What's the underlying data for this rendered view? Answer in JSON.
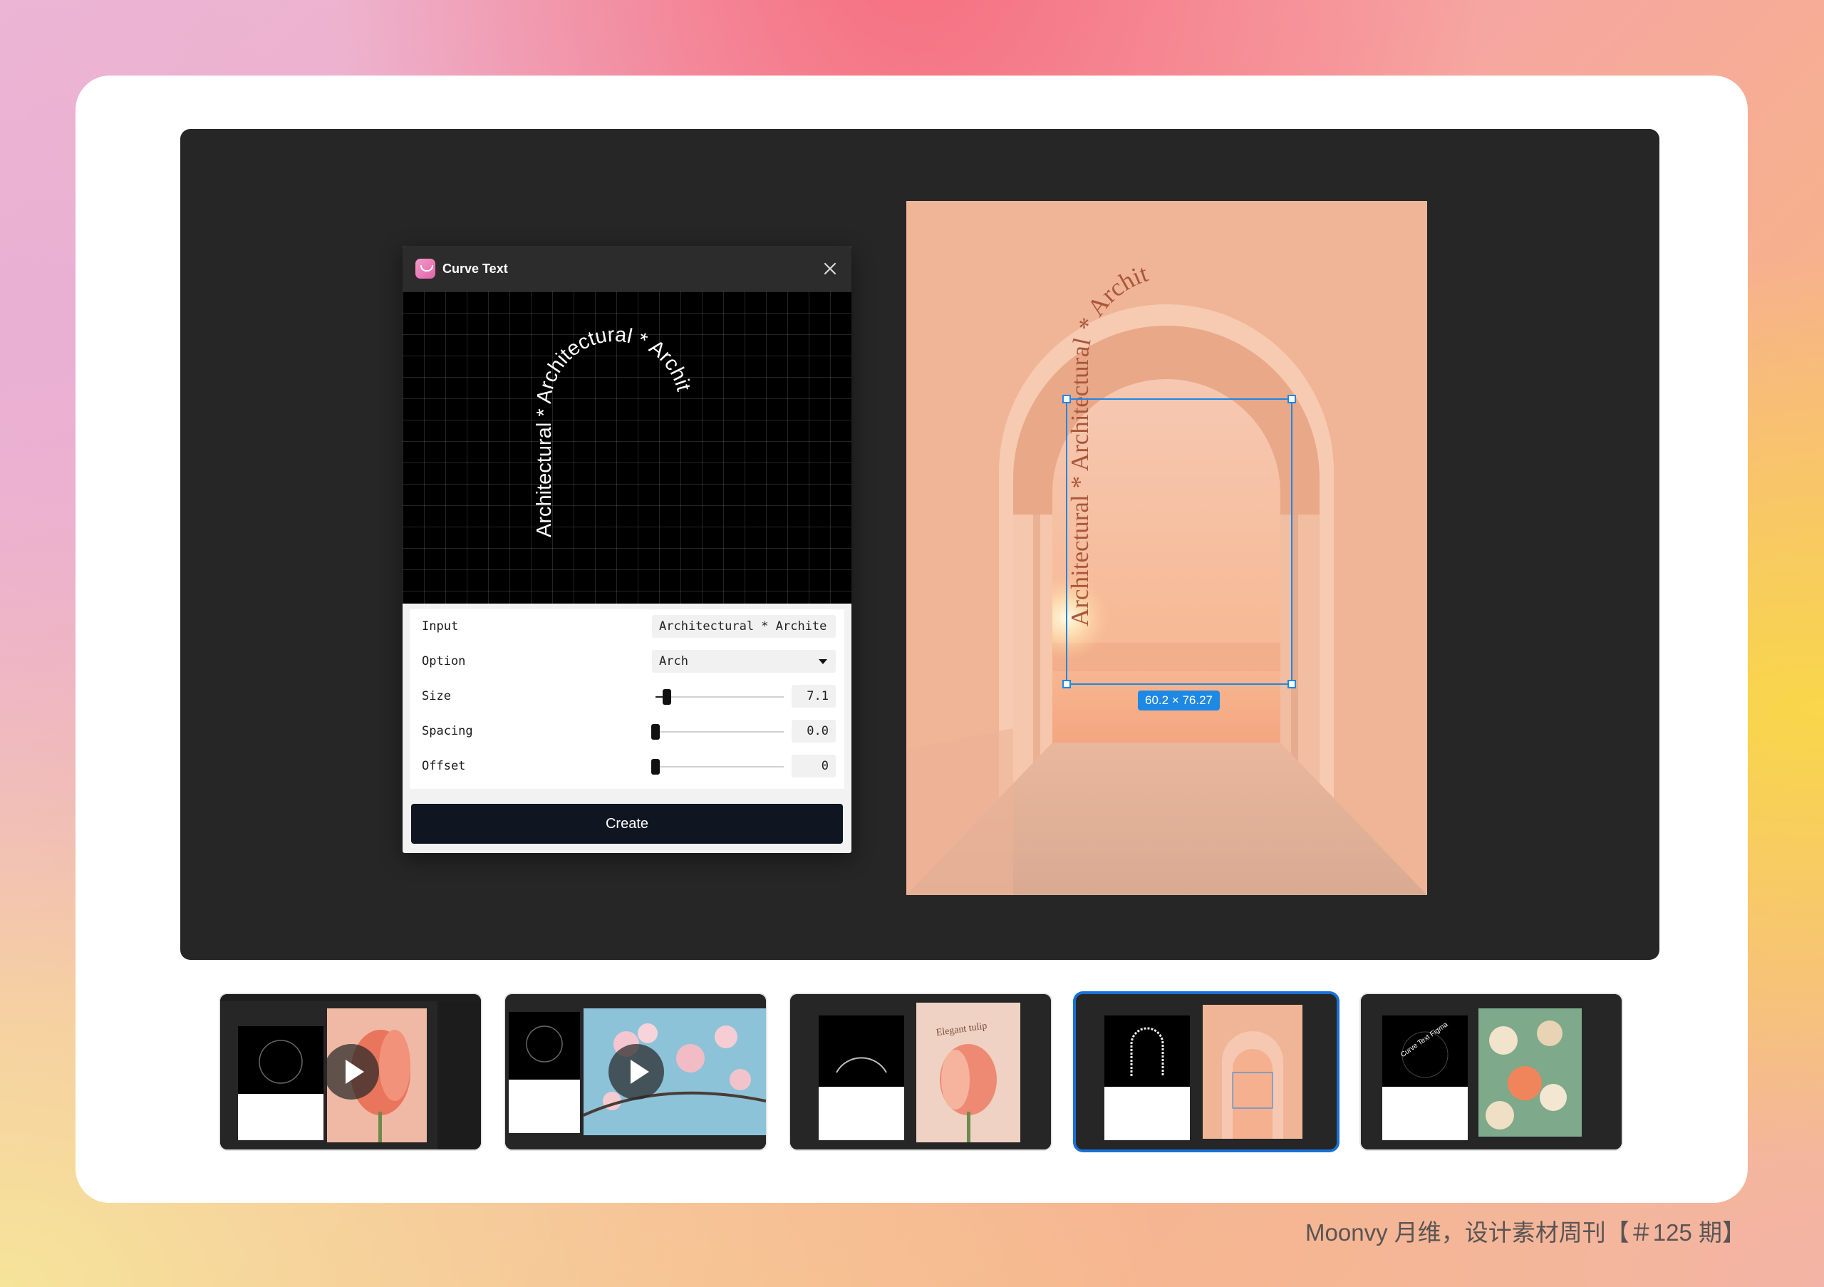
{
  "plugin": {
    "title": "Curve Text",
    "preview_text": "Architectural * Architectural * Archit",
    "fields": {
      "input_label": "Input",
      "input_value": "Architectural * Archite",
      "option_label": "Option",
      "option_value": "Arch",
      "size_label": "Size",
      "size_value": "7.1",
      "spacing_label": "Spacing",
      "spacing_value": "0.0",
      "offset_label": "Offset",
      "offset_value": "0"
    },
    "sliders": {
      "size_fraction": 0.09,
      "spacing_fraction": 0.0,
      "offset_fraction": 0.0
    },
    "create_label": "Create"
  },
  "canvas": {
    "curved_text": "Architectural * Architectural * Archit",
    "selection_size": "60.2 × 76.27",
    "accent_color": "#1e88e5",
    "text_color": "#a9563a"
  },
  "thumbnails": [
    {
      "name": "tulip-video",
      "has_play": true,
      "active": false,
      "art_text": ""
    },
    {
      "name": "blossom-video",
      "has_play": true,
      "active": false,
      "art_text": ""
    },
    {
      "name": "elegant-tulip",
      "has_play": false,
      "active": false,
      "art_text": "Elegant tulip"
    },
    {
      "name": "architectural-arch",
      "has_play": false,
      "active": true,
      "art_text": ""
    },
    {
      "name": "curve-text-figma",
      "has_play": false,
      "active": false,
      "art_text": "Curve Text Figma"
    }
  ],
  "caption": "Moonvy 月维，设计素材周刊【＃125 期】",
  "icons": [
    "plugin-logo-icon",
    "close-icon",
    "chevron-down-icon",
    "play-icon"
  ]
}
